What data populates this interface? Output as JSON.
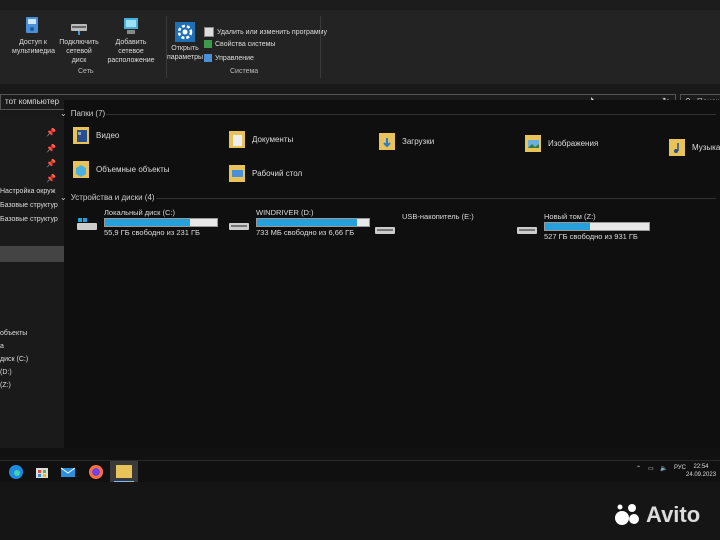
{
  "ribbon": {
    "media_access": {
      "line1": "Доступ к",
      "line2": "мультимедиа"
    },
    "map_drive": {
      "line1": "Подключить",
      "line2": "сетевой диск"
    },
    "add_location": {
      "line1": "Добавить сетевое",
      "line2": "расположение"
    },
    "network_group": "Сеть",
    "open_settings": {
      "line1": "Открыть",
      "line2": "параметры"
    },
    "uninstall": "Удалить или изменить программу",
    "system_properties": "Свойства системы",
    "manage": "Управление",
    "system_group": "Система"
  },
  "address": {
    "path": "тот компьютер",
    "search_placeholder": "Поиск"
  },
  "nav": {
    "items": [
      "Настройка окруж",
      "Базовые структур",
      "Базовые структур",
      "объекты",
      "а",
      "диск (C:)",
      "(D:)",
      "(Z:)"
    ]
  },
  "folders": {
    "title": "Папки (7)",
    "items": [
      {
        "name": "Видео",
        "icon": "video-folder-icon"
      },
      {
        "name": "Документы",
        "icon": "documents-folder-icon"
      },
      {
        "name": "Загрузки",
        "icon": "downloads-folder-icon"
      },
      {
        "name": "Изображения",
        "icon": "pictures-folder-icon"
      },
      {
        "name": "Музыка",
        "icon": "music-folder-icon"
      },
      {
        "name": "Объемные объекты",
        "icon": "3d-objects-folder-icon"
      },
      {
        "name": "Рабочий стол",
        "icon": "desktop-folder-icon"
      }
    ]
  },
  "drives": {
    "title": "Устройства и диски (4)",
    "items": [
      {
        "name": "Локальный диск (C:)",
        "free": "55,9 ГБ свободно из 231 ГБ",
        "used_fraction": 0.76,
        "icon": "windows-drive-icon"
      },
      {
        "name": "WINDRIVER (D:)",
        "free": "733 МБ свободно из 6,66 ГБ",
        "used_fraction": 0.89,
        "icon": "drive-icon"
      },
      {
        "name": "USB-накопитель (E:)",
        "free": "",
        "used_fraction": null,
        "icon": "usb-drive-icon"
      },
      {
        "name": "Новый том (Z:)",
        "free": "527 ГБ свободно из 931 ГБ",
        "used_fraction": 0.43,
        "icon": "drive-icon"
      }
    ]
  },
  "taskbar": {
    "lang": "РУС",
    "time": "22:54",
    "date": "24.09.2023"
  },
  "watermark": "Avito",
  "colors": {
    "accent": "#26a0da",
    "folder": "#e8c35a"
  }
}
